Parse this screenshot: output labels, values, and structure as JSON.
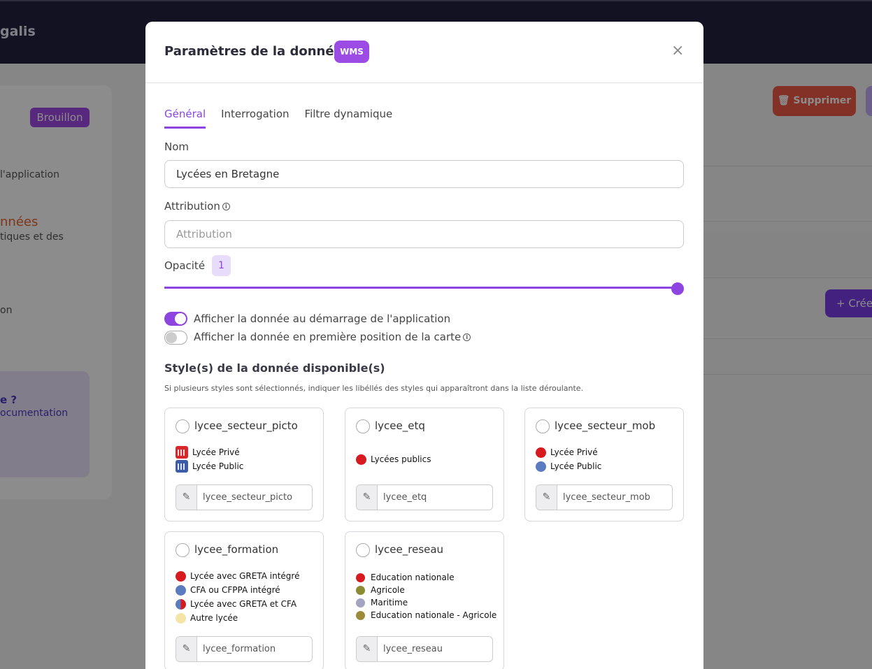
{
  "background": {
    "brand_partial": "galis",
    "status_badge": "Brouillon",
    "sidebar_lines": [
      "l'application",
      "nnées",
      "tiques et des",
      "on"
    ],
    "help_question": "e ?",
    "help_link": "ocumentation",
    "delete_button": "Supprimer",
    "create_button": "+ Crée"
  },
  "modal": {
    "title": "Paramètres de la donnée",
    "type_badge": "WMS",
    "close_glyph": "×",
    "tabs": [
      "Général",
      "Interrogation",
      "Filtre dynamique"
    ],
    "active_tab": 0,
    "nom_label": "Nom",
    "nom_value": "Lycées en Bretagne",
    "attribution_label": "Attribution",
    "attribution_placeholder": "Attribution",
    "opacity_label": "Opacité",
    "opacity_value": "1",
    "toggles": [
      {
        "label": "Afficher la donnée au démarrage de l'application",
        "on": true
      },
      {
        "label": "Afficher la donnée en première position de la carte",
        "on": false
      }
    ],
    "styles_title": "Style(s) de la donnée disponible(s)",
    "styles_help": "Si plusieurs styles sont sélectionnés, indiquer les libéllés des styles qui apparaîtront dans la liste déroulante.",
    "styles": [
      {
        "name": "lycee_secteur_picto",
        "input_value": "lycee_secteur_picto",
        "legend": [
          {
            "label": "Lycée Privé",
            "color": "#d8262b",
            "kind": "picto"
          },
          {
            "label": "Lycée Public",
            "color": "#3d5ca8",
            "kind": "picto"
          }
        ]
      },
      {
        "name": "lycee_etq",
        "input_value": "lycee_etq",
        "legend": [
          {
            "label": "Lycées publics",
            "color": "#d71920",
            "kind": "dot"
          }
        ]
      },
      {
        "name": "lycee_secteur_mob",
        "input_value": "lycee_secteur_mob",
        "legend": [
          {
            "label": "Lycée Privé",
            "color": "#d71920",
            "kind": "dot"
          },
          {
            "label": "Lycée Public",
            "color": "#5a7bbf",
            "kind": "dot"
          }
        ]
      },
      {
        "name": "lycee_formation",
        "input_value": "lycee_formation",
        "legend": [
          {
            "label": "Lycée avec GRETA intégré",
            "color": "#d71920",
            "kind": "dot"
          },
          {
            "label": "CFA ou CFPPA intégré",
            "color": "#5a7bbf",
            "kind": "dot"
          },
          {
            "label": "Lycée avec GRETA et CFA",
            "color": "#d71920",
            "color2": "#5a7bbf",
            "kind": "half"
          },
          {
            "label": "Autre lycée",
            "color": "#f4e4a6",
            "kind": "dot"
          }
        ]
      },
      {
        "name": "lycee_reseau",
        "input_value": "lycee_reseau",
        "legend": [
          {
            "label": "Education nationale",
            "color": "#d71920",
            "kind": "dot-sm"
          },
          {
            "label": "Agricole",
            "color": "#8b8b33",
            "kind": "dot-sm"
          },
          {
            "label": "Maritime",
            "color": "#a3a3c2",
            "kind": "dot-sm"
          },
          {
            "label": "Education nationale - Agricole",
            "color": "#9a8a3a",
            "kind": "dot-sm"
          }
        ]
      }
    ]
  }
}
